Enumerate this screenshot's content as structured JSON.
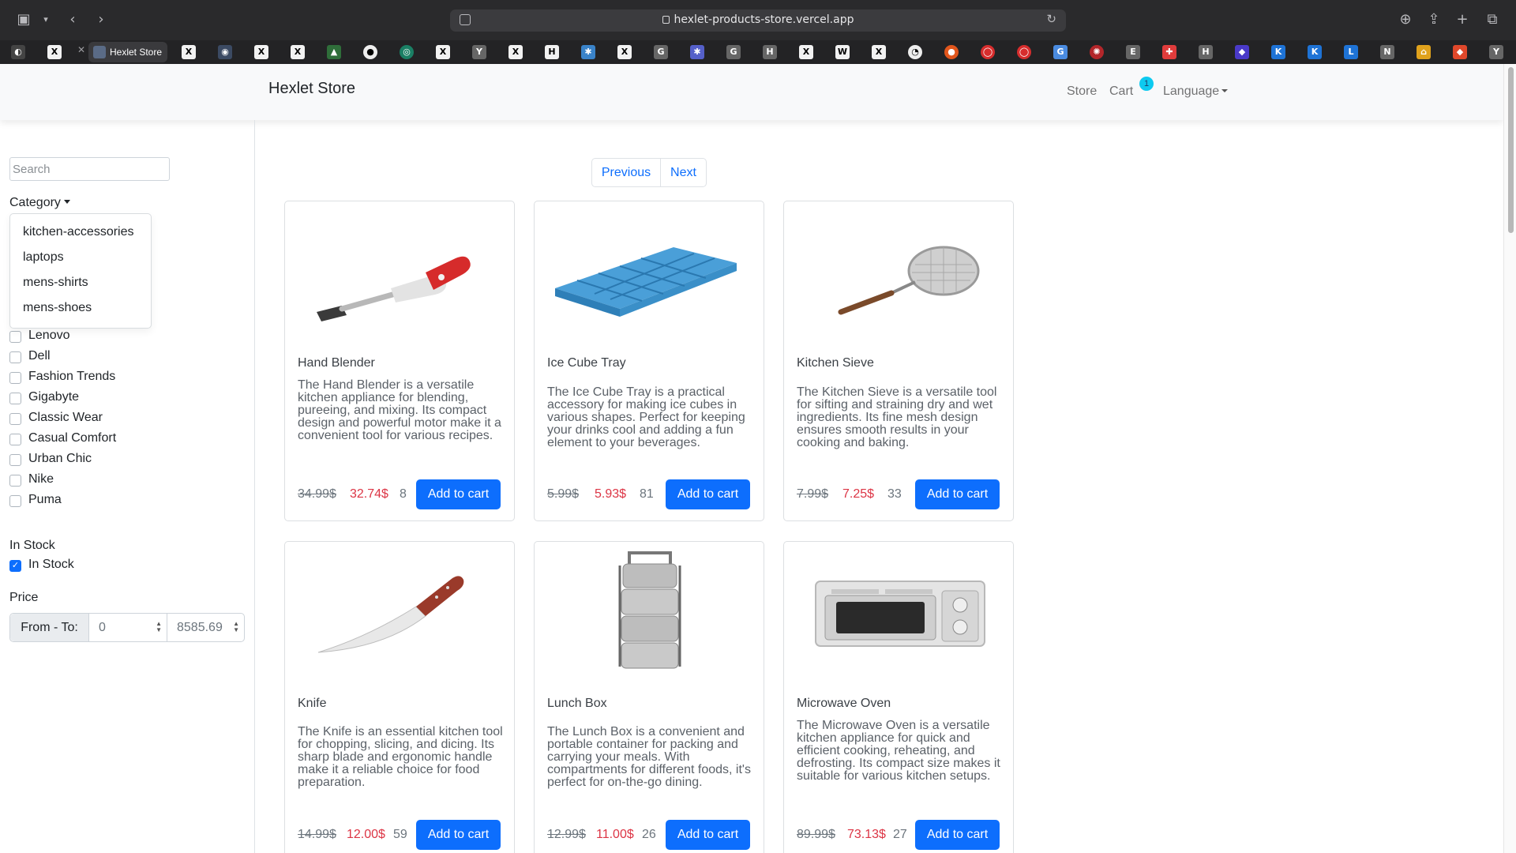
{
  "browser": {
    "url": "hexlet-products-store.vercel.app",
    "active_tab": "Hexlet Store"
  },
  "navbar": {
    "brand": "Hexlet Store",
    "store": "Store",
    "cart": "Cart",
    "cart_count": "1",
    "language": "Language"
  },
  "sidebar": {
    "search_placeholder": "Search",
    "category_label": "Category",
    "categories": [
      "kitchen-accessories",
      "laptops",
      "mens-shirts",
      "mens-shoes"
    ],
    "brands": [
      "Lenovo",
      "Dell",
      "Fashion Trends",
      "Gigabyte",
      "Classic Wear",
      "Casual Comfort",
      "Urban Chic",
      "Nike",
      "Puma"
    ],
    "stock_heading": "In Stock",
    "stock_label": "In Stock",
    "stock_checked": true,
    "price_heading": "Price",
    "price_prefix": "From - To:",
    "price_from": "0",
    "price_to": "8585.69"
  },
  "pagination": {
    "previous": "Previous",
    "next": "Next"
  },
  "products": [
    {
      "title": "Hand Blender",
      "description": "The Hand Blender is a versatile kitchen appliance for blending, pureeing, and mixing. Its compact design and powerful motor make it a convenient tool for various recipes.",
      "old_price": "34.99$",
      "price": "32.74$",
      "stock": "8",
      "button": "Add to cart"
    },
    {
      "title": "Ice Cube Tray",
      "description": "The Ice Cube Tray is a practical accessory for making ice cubes in various shapes. Perfect for keeping your drinks cool and adding a fun element to your beverages.",
      "old_price": "5.99$",
      "price": "5.93$",
      "stock": "81",
      "button": "Add to cart"
    },
    {
      "title": "Kitchen Sieve",
      "description": "The Kitchen Sieve is a versatile tool for sifting and straining dry and wet ingredients. Its fine mesh design ensures smooth results in your cooking and baking.",
      "old_price": "7.99$",
      "price": "7.25$",
      "stock": "33",
      "button": "Add to cart"
    },
    {
      "title": "Knife",
      "description": "The Knife is an essential kitchen tool for chopping, slicing, and dicing. Its sharp blade and ergonomic handle make it a reliable choice for food preparation.",
      "old_price": "14.99$",
      "price": "12.00$",
      "stock": "59",
      "button": "Add to cart"
    },
    {
      "title": "Lunch Box",
      "description": "The Lunch Box is a convenient and portable container for packing and carrying your meals. With compartments for different foods, it's perfect for on-the-go dining.",
      "old_price": "12.99$",
      "price": "11.00$",
      "stock": "26",
      "button": "Add to cart"
    },
    {
      "title": "Microwave Oven",
      "description": "The Microwave Oven is a versatile kitchen appliance for quick and efficient cooking, reheating, and defrosting. Its compact size makes it suitable for various kitchen setups.",
      "old_price": "89.99$",
      "price": "73.13$",
      "stock": "27",
      "button": "Add to cart"
    }
  ],
  "colors": {
    "primary": "#0d6efd",
    "sale": "#dc3545",
    "badge": "#0dcaf0"
  }
}
